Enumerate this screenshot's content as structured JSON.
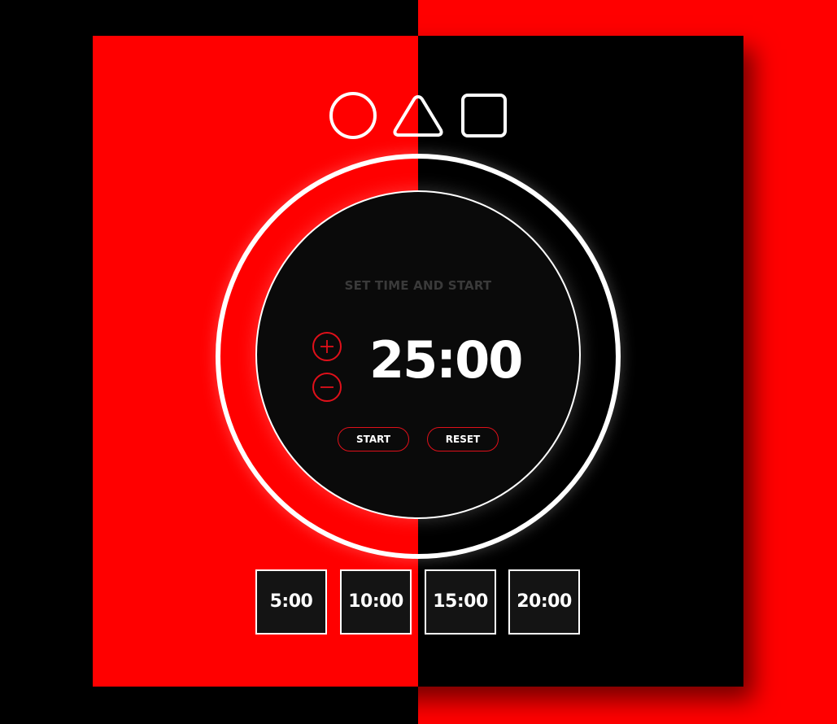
{
  "header": {
    "icons": [
      "circle-icon",
      "triangle-icon",
      "square-icon"
    ]
  },
  "timer": {
    "status": "SET TIME AND START",
    "display": "25:00",
    "increase_label": "+",
    "decrease_label": "−",
    "start_label": "START",
    "reset_label": "RESET"
  },
  "presets": [
    "5:00",
    "10:00",
    "15:00",
    "20:00"
  ],
  "colors": {
    "red": "#ff0000",
    "accent": "#e0101a",
    "black": "#000000",
    "disc": "#0a0a0a",
    "preset_bg": "#141414",
    "status_text": "#3a3a3a",
    "white": "#ffffff"
  }
}
